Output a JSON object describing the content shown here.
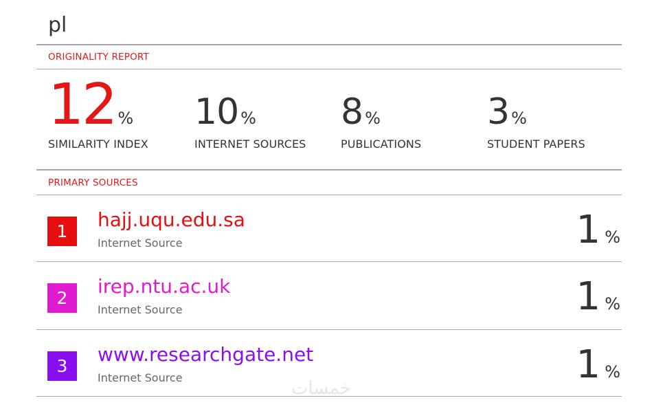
{
  "document": {
    "title": "pl"
  },
  "report": {
    "originality_label": "ORIGINALITY REPORT",
    "primary_label": "PRIMARY SOURCES",
    "stats": [
      {
        "value": "12",
        "unit": "%",
        "label": "SIMILARITY INDEX",
        "color": "#e51616"
      },
      {
        "value": "10",
        "unit": "%",
        "label": "INTERNET SOURCES"
      },
      {
        "value": "8",
        "unit": "%",
        "label": "PUBLICATIONS"
      },
      {
        "value": "3",
        "unit": "%",
        "label": "STUDENT PAPERS"
      }
    ],
    "sources": [
      {
        "rank": "1",
        "name": "hajj.uqu.edu.sa",
        "type": "Internet Source",
        "percent": "1",
        "unit": "%",
        "color": "#e60e0e"
      },
      {
        "rank": "2",
        "name": "irep.ntu.ac.uk",
        "type": "Internet Source",
        "percent": "1",
        "unit": "%",
        "color": "#e01bcf"
      },
      {
        "rank": "3",
        "name": "www.researchgate.net",
        "type": "Internet Source",
        "percent": "1",
        "unit": "%",
        "color": "#8a0ff0"
      }
    ]
  },
  "watermark": {
    "text": "خمسات"
  }
}
